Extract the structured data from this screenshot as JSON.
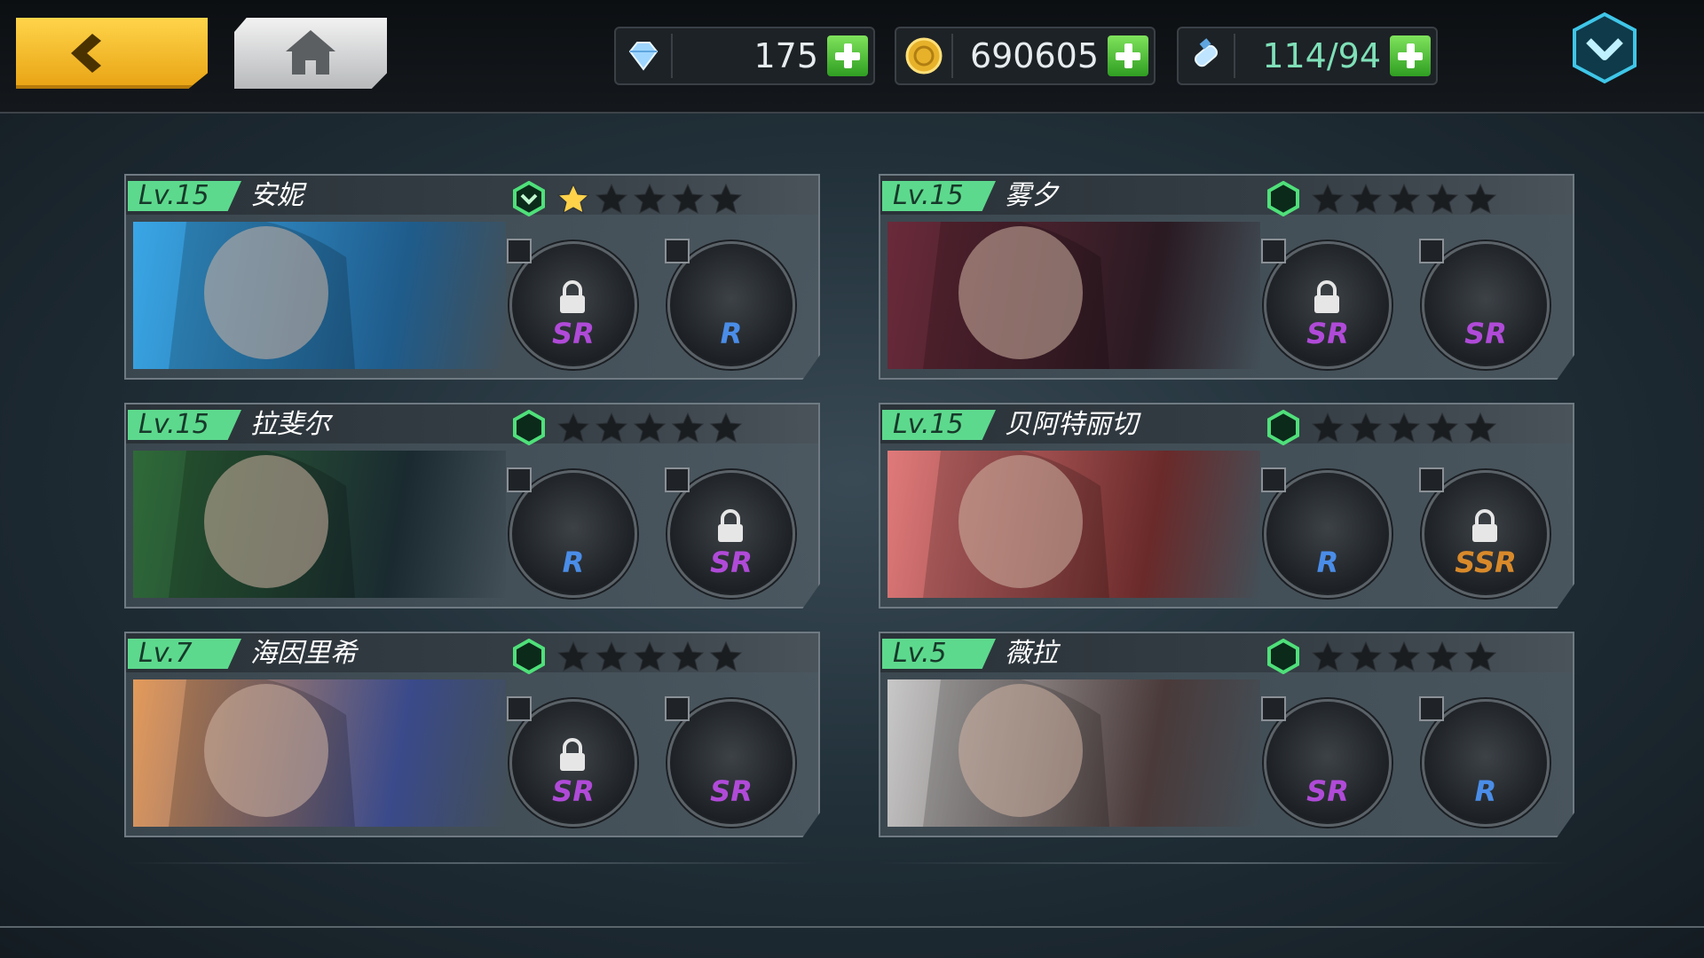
{
  "header": {
    "back_label": "back",
    "home_label": "home",
    "resources": [
      {
        "icon": "diamond-icon",
        "value": "175"
      },
      {
        "icon": "gold-coin-icon",
        "value": "690605"
      },
      {
        "icon": "stamina-potion-icon",
        "value": "114/94"
      }
    ],
    "menu_icon": "chevron-down-hex-icon"
  },
  "characters": [
    {
      "level": "Lv.15",
      "name": "安妮",
      "rank_icon": "rank-up-hex-icon",
      "stars_lit": 1,
      "weapons": [
        {
          "rarity": "SR",
          "locked": true
        },
        {
          "rarity": "R",
          "locked": false
        }
      ]
    },
    {
      "level": "Lv.15",
      "name": "雾夕",
      "rank_icon": "rank-hex-icon",
      "stars_lit": 0,
      "weapons": [
        {
          "rarity": "SR",
          "locked": true
        },
        {
          "rarity": "SR",
          "locked": false
        }
      ]
    },
    {
      "level": "Lv.15",
      "name": "拉斐尔",
      "rank_icon": "rank-hex-icon",
      "stars_lit": 0,
      "weapons": [
        {
          "rarity": "R",
          "locked": false
        },
        {
          "rarity": "SR",
          "locked": true
        }
      ]
    },
    {
      "level": "Lv.15",
      "name": "贝阿特丽切",
      "rank_icon": "rank-hex-icon",
      "stars_lit": 0,
      "weapons": [
        {
          "rarity": "R",
          "locked": false
        },
        {
          "rarity": "SSR",
          "locked": true
        }
      ]
    },
    {
      "level": "Lv.7",
      "name": "海因里希",
      "rank_icon": "rank-hex-icon",
      "stars_lit": 0,
      "weapons": [
        {
          "rarity": "SR",
          "locked": true
        },
        {
          "rarity": "SR",
          "locked": false
        }
      ]
    },
    {
      "level": "Lv.5",
      "name": "薇拉",
      "rank_icon": "rank-hex-icon",
      "stars_lit": 0,
      "weapons": [
        {
          "rarity": "SR",
          "locked": false
        },
        {
          "rarity": "R",
          "locked": false
        }
      ]
    }
  ],
  "colors": {
    "level_tag": "#5dd98d",
    "rarity_R": "#4a8de8",
    "rarity_SR": "#b04ad8",
    "rarity_SSR": "#d98a2a",
    "star_lit": "#ffd24a",
    "star_dim": "#1a1d20"
  }
}
